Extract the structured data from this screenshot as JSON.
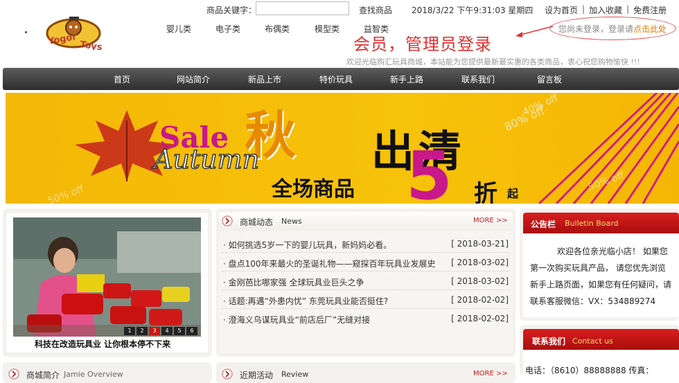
{
  "header": {
    "keyword_label": "商品关键字：",
    "keyword_placeholder": "",
    "search_button": "查找商品",
    "datetime": "2018/3/22 下午9:31:03 星期四",
    "links": [
      "设为首页",
      "加入收藏",
      "免费注册"
    ],
    "categories": [
      "婴儿类",
      "电子类",
      "布偶类",
      "模型类",
      "益智类"
    ],
    "login_prompt": "您尚未登录，登录请",
    "login_link": "点击此处",
    "annotation": "会员，管理员登录",
    "welcome": "欢迎光临购汇玩具商城，本站能为您提供最新最实惠的各类商品，衷心祝您购物愉快 !!!"
  },
  "nav": [
    "首页",
    "网站简介",
    "新品上市",
    "特价玩具",
    "新手上路",
    "联系我们",
    "留言板"
  ],
  "banner": {
    "sale": "Sale",
    "autumn_char": "秋",
    "clearance": "出清",
    "autumn_en": "Autumn",
    "all_goods": "全场商品",
    "discount_num": "5",
    "discount_zhe": "折",
    "discount_qi": "起",
    "off_marks": [
      "40% off",
      "80% off",
      "50% off",
      "50% off"
    ]
  },
  "photo": {
    "caption": "科技在改造玩具业 让你根本停不下来",
    "pager": [
      "1",
      "2",
      "3",
      "4",
      "5",
      "6"
    ]
  },
  "news": {
    "title_cn": "商城动态",
    "title_en": "News",
    "more": "MORE >>",
    "items": [
      {
        "title": "· 如何挑选5岁一下的婴儿玩具，新妈妈必看。",
        "date": "[ 2018-03-21]"
      },
      {
        "title": "· 盘点100年来最火的圣诞礼物——窥探百年玩具业发展史",
        "date": "[ 2018-03-02]"
      },
      {
        "title": "· 金刚芭比哪家强 全球玩具业巨头之争",
        "date": "[ 2018-03-02]"
      },
      {
        "title": "· 话题:再遇“外患内忧” 东莞玩具业能否挺住?",
        "date": "[ 2018-02-02]"
      },
      {
        "title": "· 澄海义乌谋玩具业“前店后厂”无缝对接",
        "date": "[ 2018-02-02]"
      }
    ]
  },
  "bulletin": {
    "title_cn": "公告栏",
    "title_en": "Bulletin Board",
    "lines": [
      "欢迎各位亲光临小店！ 如果您",
      "第一次购买玩具产品， 请您优先浏览",
      "新手上路页面，如果您有任何疑问，请",
      "联系客服微信：VX：534889274"
    ]
  },
  "contact": {
    "title_cn": "联系我们",
    "title_en": "Contact us",
    "line": "电话：（8610）88888888 传真："
  },
  "bottom": {
    "intro_cn": "商城简介",
    "intro_en": "Jamie Overview",
    "recent_cn": "近期活动",
    "recent_en": "Review",
    "more": "MORE >>"
  },
  "colors": {
    "nav_bg": "#3f3f3f",
    "accent_red": "#c0141a",
    "banner_yellow": "#f5bd08",
    "link_orange": "#e07a00"
  }
}
